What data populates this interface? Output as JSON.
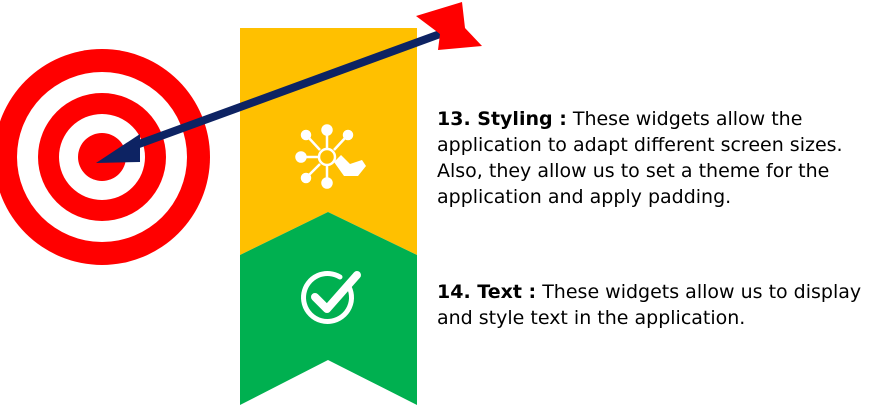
{
  "colors": {
    "target_red": "#ff0000",
    "arrow_navy": "#0d2363",
    "ribbon_yellow": "#ffc000",
    "ribbon_green": "#00b050",
    "icon_white": "#ffffff"
  },
  "icons": {
    "styling": "network-hand-icon",
    "text": "check-circle-icon"
  },
  "items": [
    {
      "number": "13.",
      "title": "13. Styling :",
      "body": "These widgets allow the application to adapt different screen sizes. Also, they allow us to set a theme for the application and apply padding."
    },
    {
      "number": "14.",
      "title": "14. Text :",
      "body": "These widgets allow us to display and style text in the application."
    }
  ]
}
